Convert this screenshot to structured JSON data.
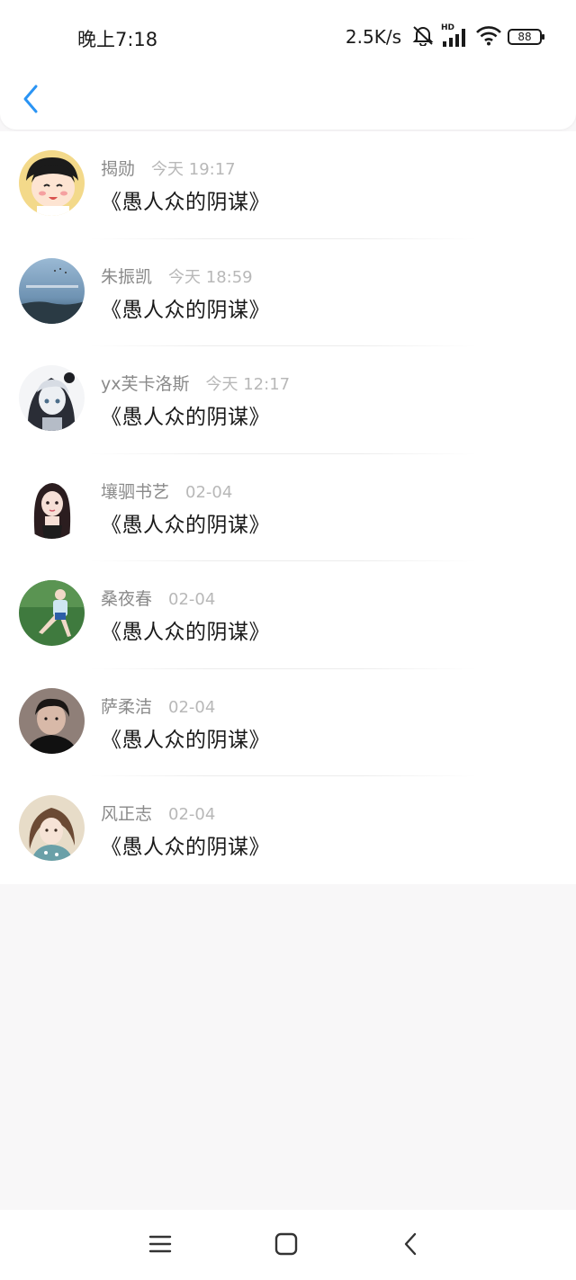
{
  "status_bar": {
    "time": "晚上7:18",
    "net_speed": "2.5K/s",
    "hd_label": "HD",
    "battery": "88",
    "icons": [
      "mute-bell-icon",
      "signal-icon",
      "wifi-icon",
      "battery-icon"
    ]
  },
  "header": {
    "back_icon": "chevron-left-icon",
    "accent_color": "#2a94f4"
  },
  "list": {
    "items": [
      {
        "name": "揭勋",
        "time": "今天 19:17",
        "title": "《愚人众的阴谋》"
      },
      {
        "name": "朱振凯",
        "time": "今天 18:59",
        "title": "《愚人众的阴谋》"
      },
      {
        "name": "yx芙卡洛斯",
        "time": "今天 12:17",
        "title": "《愚人众的阴谋》"
      },
      {
        "name": "壤驷书艺",
        "time": "02-04",
        "title": "《愚人众的阴谋》"
      },
      {
        "name": "桑夜春",
        "time": "02-04",
        "title": "《愚人众的阴谋》"
      },
      {
        "name": "萨柔洁",
        "time": "02-04",
        "title": "《愚人众的阴谋》"
      },
      {
        "name": "风正志",
        "time": "02-04",
        "title": "《愚人众的阴谋》"
      }
    ]
  },
  "nav_bar": {
    "icons": [
      "menu-icon",
      "home-icon",
      "back-icon"
    ]
  }
}
